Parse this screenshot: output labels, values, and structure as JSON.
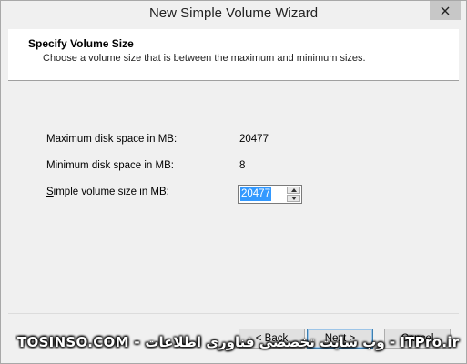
{
  "window": {
    "title": "New Simple Volume Wizard"
  },
  "header": {
    "title": "Specify Volume Size",
    "subtitle": "Choose a volume size that is between the maximum and minimum sizes."
  },
  "fields": {
    "max_label": "Maximum disk space in MB:",
    "max_value": "20477",
    "min_label": "Minimum disk space in MB:",
    "min_value": "8",
    "size_label_prefix": "S",
    "size_label_rest": "imple volume size in MB:",
    "size_value": "20477"
  },
  "buttons": {
    "back": "< Back",
    "next": "Next >",
    "cancel": "Cancel"
  },
  "watermark": {
    "text": "TOSINSO.COM - وب سایت تخصصی فناوری اطلاعات - ITPro.ir"
  },
  "icons": {
    "close": "close-icon",
    "spin_up": "chevron-up-icon",
    "spin_down": "chevron-down-icon"
  }
}
